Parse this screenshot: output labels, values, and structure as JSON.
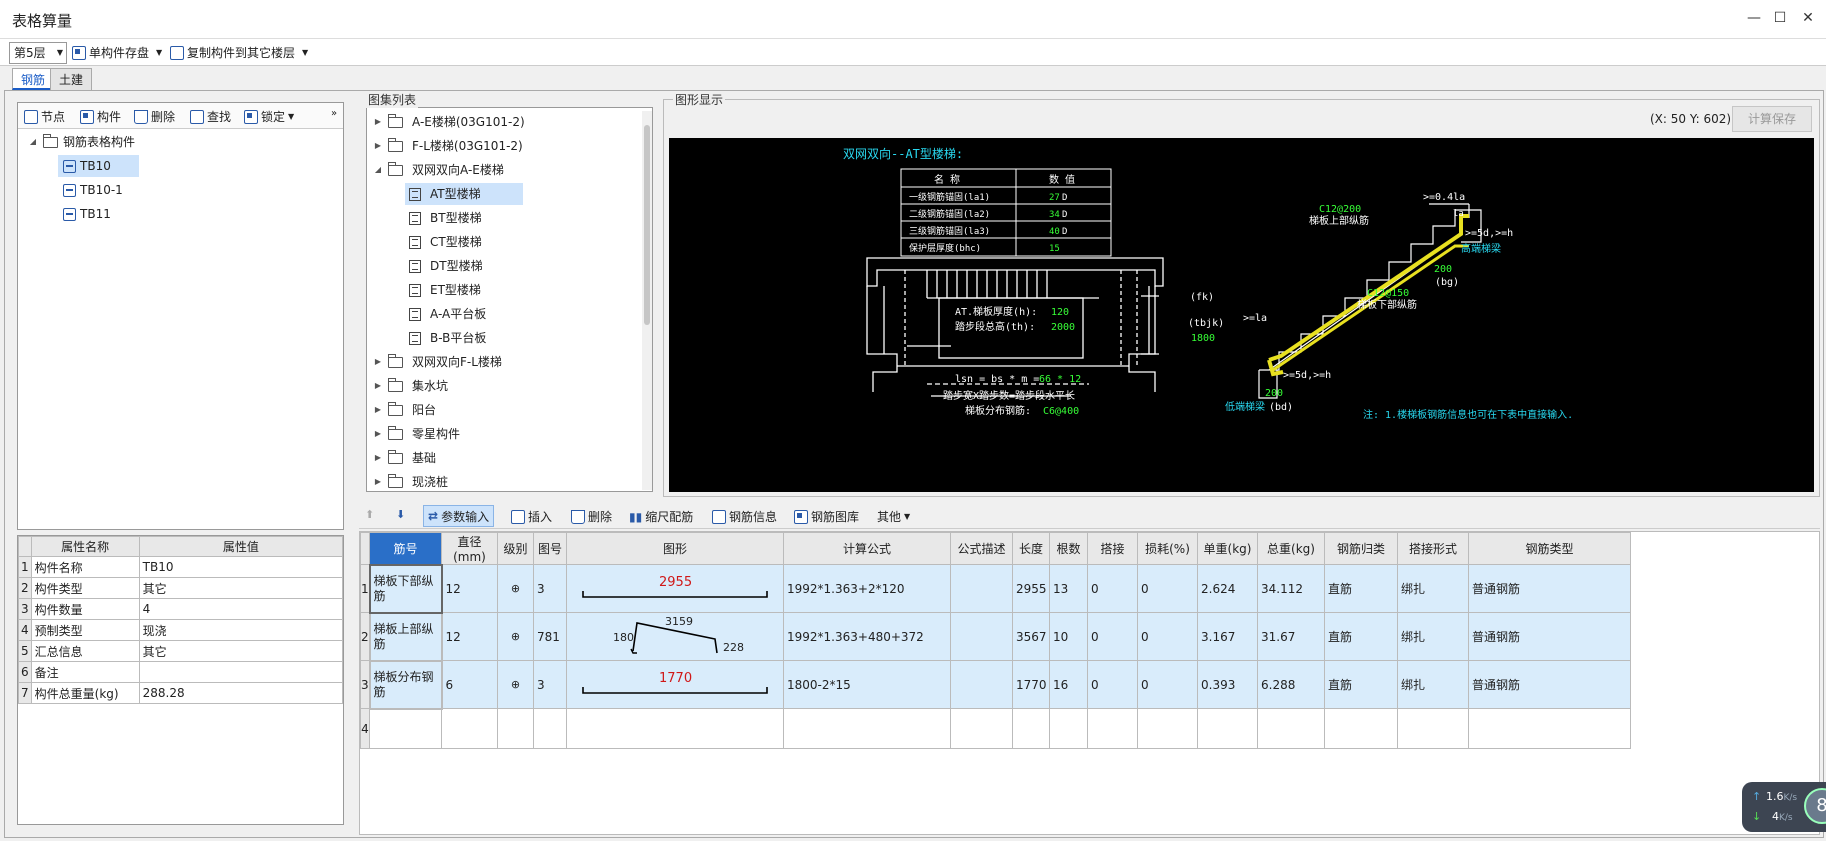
{
  "window": {
    "title": "表格算量"
  },
  "toolbar": {
    "floor": "第5层",
    "save_single": "单构件存盘",
    "copy_to_floor": "复制构件到其它楼层"
  },
  "tabs": [
    "钢筋",
    "土建"
  ],
  "left_panel": {
    "toolbar": [
      "节点",
      "构件",
      "删除",
      "查找",
      "锁定"
    ],
    "tree_root": "钢筋表格构件",
    "tree_items": [
      "TB10",
      "TB10-1",
      "TB11"
    ]
  },
  "props": {
    "headers": [
      "属性名称",
      "属性值"
    ],
    "rows": [
      {
        "n": "1",
        "name": "构件名称",
        "value": "TB10"
      },
      {
        "n": "2",
        "name": "构件类型",
        "value": "其它"
      },
      {
        "n": "3",
        "name": "构件数量",
        "value": "4"
      },
      {
        "n": "4",
        "name": "预制类型",
        "value": "现浇"
      },
      {
        "n": "5",
        "name": "汇总信息",
        "value": "其它"
      },
      {
        "n": "6",
        "name": "备注",
        "value": ""
      },
      {
        "n": "7",
        "name": "构件总重量(kg)",
        "value": "288.28"
      }
    ]
  },
  "atlas": {
    "title": "图集列表",
    "items": [
      {
        "label": "A-E楼梯(03G101-2)",
        "type": "folder",
        "state": "collapsed"
      },
      {
        "label": "F-L楼梯(03G101-2)",
        "type": "folder",
        "state": "collapsed"
      },
      {
        "label": "双网双向A-E楼梯",
        "type": "folder",
        "state": "expanded"
      },
      {
        "label": "AT型楼梯",
        "type": "doc",
        "selected": true
      },
      {
        "label": "BT型楼梯",
        "type": "doc"
      },
      {
        "label": "CT型楼梯",
        "type": "doc"
      },
      {
        "label": "DT型楼梯",
        "type": "doc"
      },
      {
        "label": "ET型楼梯",
        "type": "doc"
      },
      {
        "label": "A-A平台板",
        "type": "doc"
      },
      {
        "label": "B-B平台板",
        "type": "doc"
      },
      {
        "label": "双网双向F-L楼梯",
        "type": "folder",
        "state": "collapsed"
      },
      {
        "label": "集水坑",
        "type": "folder",
        "state": "collapsed"
      },
      {
        "label": "阳台",
        "type": "folder",
        "state": "collapsed"
      },
      {
        "label": "零星构件",
        "type": "folder",
        "state": "collapsed"
      },
      {
        "label": "基础",
        "type": "folder",
        "state": "collapsed"
      },
      {
        "label": "现浇桩",
        "type": "folder",
        "state": "collapsed"
      }
    ]
  },
  "graphic": {
    "title": "图形显示",
    "coords": "(X: 50 Y: 602)",
    "calc_save": "计算保存",
    "drawing": {
      "heading": "双网双向--AT型楼梯:",
      "table_headers": [
        "名 称",
        "数 值"
      ],
      "table_rows": [
        {
          "name": "一级钢筋锚固(la1)",
          "value": "27",
          "unit": "D"
        },
        {
          "name": "二级钢筋锚固(la2)",
          "value": "34",
          "unit": "D"
        },
        {
          "name": "三级钢筋锚固(la3)",
          "value": "40",
          "unit": "D"
        },
        {
          "name": "保护层厚度(bhc)",
          "value": "15",
          "unit": ""
        }
      ],
      "fk": "(fk)",
      "tbjk": "(tbjk)",
      "tbjk_value": "1800",
      "thick_label": "AT.梯板厚度(h):",
      "thick_value": "120",
      "height_label": "踏步段总高(th):",
      "height_value": "2000",
      "lsn_label": "lsn = bs * m =",
      "lsn_value": "66 * 12",
      "step_note": "踏步宽X踏步数=踏步段水平长",
      "dist_label": "梯板分布钢筋:",
      "dist_value": "C6@400",
      "top_bar": "C12@200",
      "top_bar_label": "梯板上部纵筋",
      "bot_bar": "C12@150",
      "bot_bar_label": "梯板下部纵筋",
      "high_beam": "高端梯梁",
      "low_beam": "低端梯梁",
      "bd": "(bd)",
      "bg": "(bg)",
      "v200a": "200",
      "v200b": "200",
      "ge04": ">=0.4la",
      "la_top": "la",
      "ge5d_top": ">=5d,>=h",
      "ge1a": ">=la",
      "ge5d_bot": ">=5d,>=h",
      "note": "注: 1.楼梯板钢筋信息也可在下表中直接输入."
    }
  },
  "grid_toolbar": {
    "param_input": "参数输入",
    "insert": "插入",
    "delete": "删除",
    "scale_rebar": "缩尺配筋",
    "rebar_info": "钢筋信息",
    "rebar_lib": "钢筋图库",
    "other": "其他"
  },
  "grid": {
    "headers": [
      "筋号",
      "直径(mm)",
      "级别",
      "图号",
      "图形",
      "计算公式",
      "公式描述",
      "长度",
      "根数",
      "搭接",
      "损耗(%)",
      "单重(kg)",
      "总重(kg)",
      "钢筋归类",
      "搭接形式",
      "钢筋类型"
    ],
    "rows": [
      {
        "n": "1",
        "name": "梯板下部纵筋",
        "dia": "12",
        "grade": "⊕",
        "fig": "3",
        "shape_value": "2955",
        "formula": "1992*1.363+2*120",
        "desc": "",
        "len": "2955",
        "count": "13",
        "lap": "0",
        "loss": "0",
        "unit_w": "2.624",
        "total_w": "34.112",
        "cat": "直筋",
        "lap_type": "绑扎",
        "type": "普通钢筋"
      },
      {
        "n": "2",
        "name": "梯板上部纵筋",
        "dia": "12",
        "grade": "⊕",
        "fig": "781",
        "shape_left": "180",
        "shape_mid": "3159",
        "shape_right": "228",
        "formula": "1992*1.363+480+372",
        "desc": "",
        "len": "3567",
        "count": "10",
        "lap": "0",
        "loss": "0",
        "unit_w": "3.167",
        "total_w": "31.67",
        "cat": "直筋",
        "lap_type": "绑扎",
        "type": "普通钢筋"
      },
      {
        "n": "3",
        "name": "梯板分布钢筋",
        "dia": "6",
        "grade": "⊕",
        "fig": "3",
        "shape_value": "1770",
        "formula": "1800-2*15",
        "desc": "",
        "len": "1770",
        "count": "16",
        "lap": "0",
        "loss": "0",
        "unit_w": "0.393",
        "total_w": "6.288",
        "cat": "直筋",
        "lap_type": "绑扎",
        "type": "普通钢筋"
      }
    ],
    "empty_row": "4"
  },
  "net_widget": {
    "up": "1.6",
    "up_unit": "K/s",
    "down": "4",
    "down_unit": "K/s",
    "badge": "8"
  }
}
